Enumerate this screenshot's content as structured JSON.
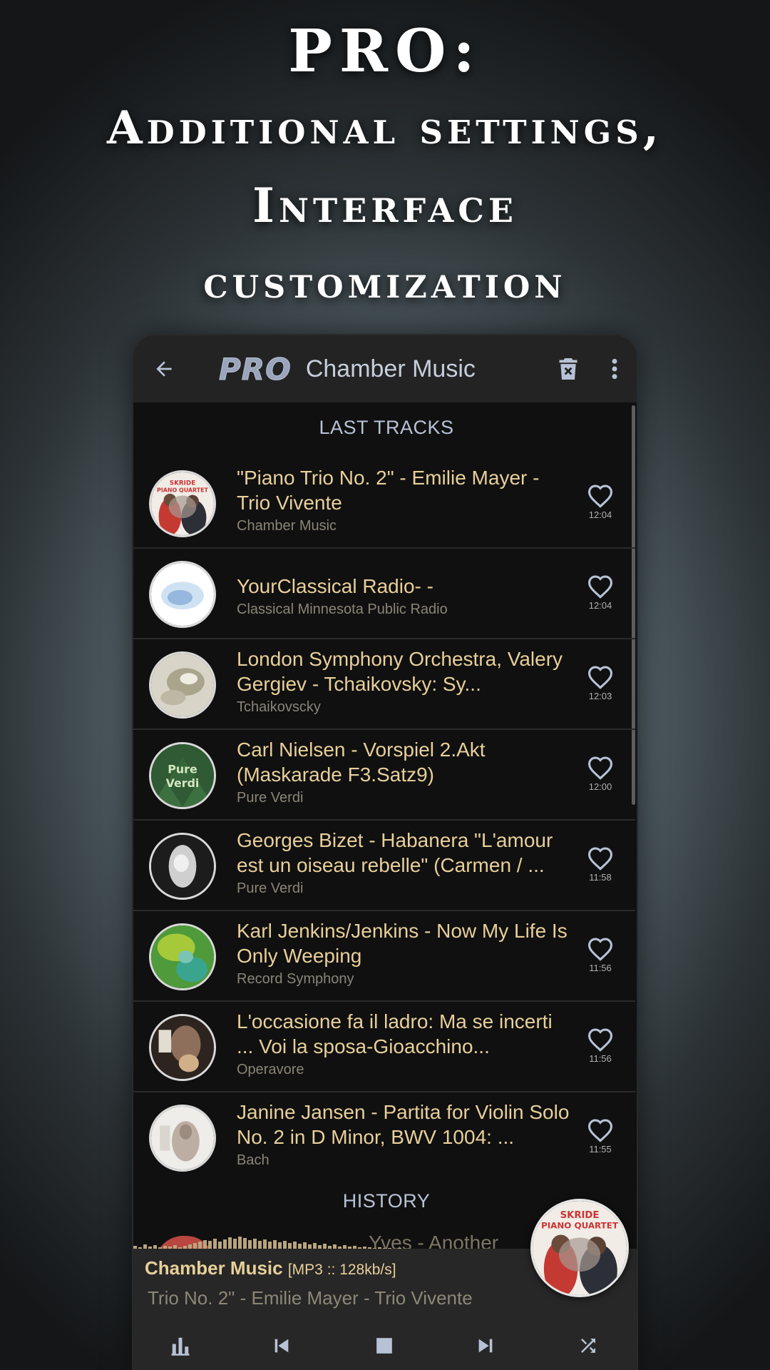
{
  "headline": {
    "line1": "PRO:",
    "line2": "Additional settings,",
    "line3": "Interface",
    "line4": "customization"
  },
  "topbar": {
    "badge": "PRO",
    "title": "Chamber Music",
    "icons": [
      "back-arrow-icon",
      "trash-icon",
      "more-vert-icon"
    ]
  },
  "sections": {
    "last_tracks": "LAST TRACKS",
    "history": "HISTORY"
  },
  "tracks": [
    {
      "title": " \"Piano Trio No. 2\" - Emilie Mayer - Trio Vivente",
      "station": "Chamber Music",
      "time": "12:04"
    },
    {
      "title": "YourClassical Radio- -",
      "station": "Classical Minnesota Public Radio",
      "time": "12:04"
    },
    {
      "title": "London Symphony Orchestra, Valery Gergiev - Tchaikovsky: Sy...",
      "station": "Tchaikovscky",
      "time": "12:03"
    },
    {
      "title": "Carl Nielsen - Vorspiel 2.Akt (Maskarade F3.Satz9)",
      "station": "Pure Verdi",
      "time": "12:00"
    },
    {
      "title": "Georges Bizet - Habanera  \"L'amour est un oiseau rebelle\" (Carmen / ...",
      "station": "Pure Verdi",
      "time": "11:58"
    },
    {
      "title": "Karl Jenkins/Jenkins - Now My Life Is Only Weeping",
      "station": "Record Symphony",
      "time": "11:56"
    },
    {
      "title": "L'occasione fa il ladro: Ma se incerti ... Voi la sposa-Gioacchino...",
      "station": "Operavore",
      "time": "11:56"
    },
    {
      "title": "Janine Jansen - Partita for Violin Solo No. 2 in D Minor, BWV 1004: ...",
      "station": "Bach",
      "time": "11:55"
    }
  ],
  "thumb_labels": {
    "skride": "SKRIDE",
    "piano_quartet": "PIANO QUARTET",
    "pure": "Pure",
    "verdi": "Verdi"
  },
  "player": {
    "station": "Chamber Music",
    "format": "[MP3 :: 128kb/s]",
    "track": "Trio No. 2\" - Emilie Mayer - Trio Vivente",
    "history_peek": "Yves - Another",
    "controls": [
      "equalizer-icon",
      "skip-previous-icon",
      "stop-icon",
      "skip-next-icon",
      "shuffle-icon"
    ]
  },
  "colors": {
    "accent_gold": "#e8cf9a",
    "muted_blue": "#b8c2d6",
    "background": "#101010"
  }
}
